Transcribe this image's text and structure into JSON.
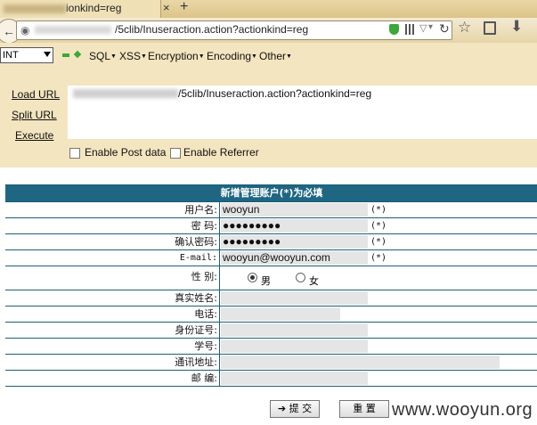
{
  "browser": {
    "tab_title_suffix": "ionkind=reg",
    "tab_close": "×",
    "tab_new": "+",
    "url_text": "/5clib/Inuseraction.action?actionkind=reg"
  },
  "hackbar": {
    "int_select": "INT",
    "menus": [
      "SQL",
      "XSS",
      "Encryption",
      "Encoding",
      "Other"
    ],
    "load_url": "Load URL",
    "split_url": "Split URL",
    "execute": "Execute",
    "textarea_url": "/5clib/Inuseraction.action?actionkind=reg",
    "enable_post": "Enable Post data",
    "enable_referrer": "Enable Referrer"
  },
  "form": {
    "header": "新增管理账户(*)为必填",
    "rows": [
      {
        "label": "用户名:",
        "value": "wooyun",
        "required": "(*)"
      },
      {
        "label": "密  码:",
        "value": "●●●●●●●●●",
        "required": "(*)"
      },
      {
        "label": "确认密码:",
        "value": "●●●●●●●●●",
        "required": "(*)"
      },
      {
        "label": "E-mail:",
        "value": "wooyun@wooyun.com",
        "required": "(*)"
      },
      {
        "label": "性  别:",
        "value": "",
        "required": ""
      },
      {
        "label": "真实姓名:",
        "value": "",
        "required": ""
      },
      {
        "label": "电话:",
        "value": "",
        "required": ""
      },
      {
        "label": "身份证号:",
        "value": "",
        "required": ""
      },
      {
        "label": "学号:",
        "value": "",
        "required": ""
      },
      {
        "label": "通讯地址:",
        "value": "",
        "required": ""
      },
      {
        "label": "邮  编:",
        "value": "",
        "required": ""
      }
    ],
    "gender_male": "男",
    "gender_female": "女",
    "submit": "提 交",
    "reset": "重 置"
  },
  "watermark": "www.wooyun.org"
}
